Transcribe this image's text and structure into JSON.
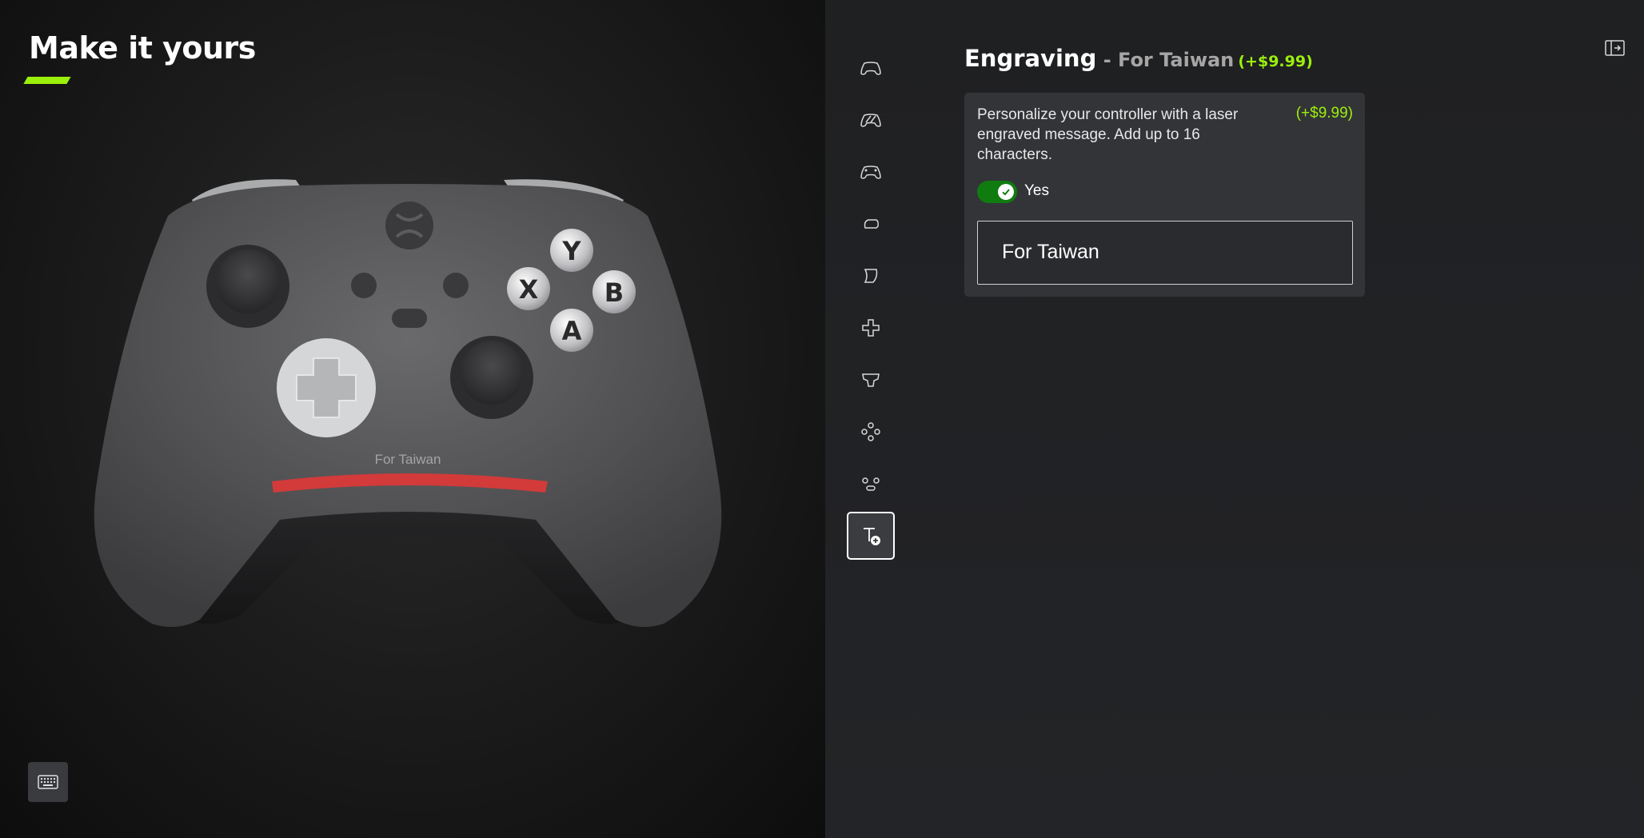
{
  "preview": {
    "title": "Make it yours",
    "engraving_text": "For Taiwan",
    "buttons": {
      "y": "Y",
      "x": "X",
      "b": "B",
      "a": "A"
    },
    "colors": {
      "body": "#5a5a5c",
      "bumper": "#a9abad",
      "dpad": "#c8cacc",
      "trigger_accent": "#d33a3a",
      "face_buttons": "#d8d8d8"
    }
  },
  "rail": {
    "items": [
      {
        "name": "body-icon"
      },
      {
        "name": "back-case-icon"
      },
      {
        "name": "bumpers-icon"
      },
      {
        "name": "trigger-icon"
      },
      {
        "name": "rear-grip-icon"
      },
      {
        "name": "dpad-icon"
      },
      {
        "name": "thumbsticks-icon"
      },
      {
        "name": "abxy-icon"
      },
      {
        "name": "view-menu-buttons-icon"
      },
      {
        "name": "engraving-icon",
        "active": true
      }
    ]
  },
  "header": {
    "section": "Engraving",
    "separator": " - ",
    "value": "For Taiwan",
    "price": "(+$9.99)"
  },
  "engraving": {
    "description": "Personalize your controller with a laser engraved message. Add up to 16 characters.",
    "price": "(+$9.99)",
    "toggle_label": "Yes",
    "toggle_on": true,
    "input_value": "For Taiwan"
  },
  "colors": {
    "accent": "#9bf00b",
    "toggle_on": "#107c10"
  }
}
